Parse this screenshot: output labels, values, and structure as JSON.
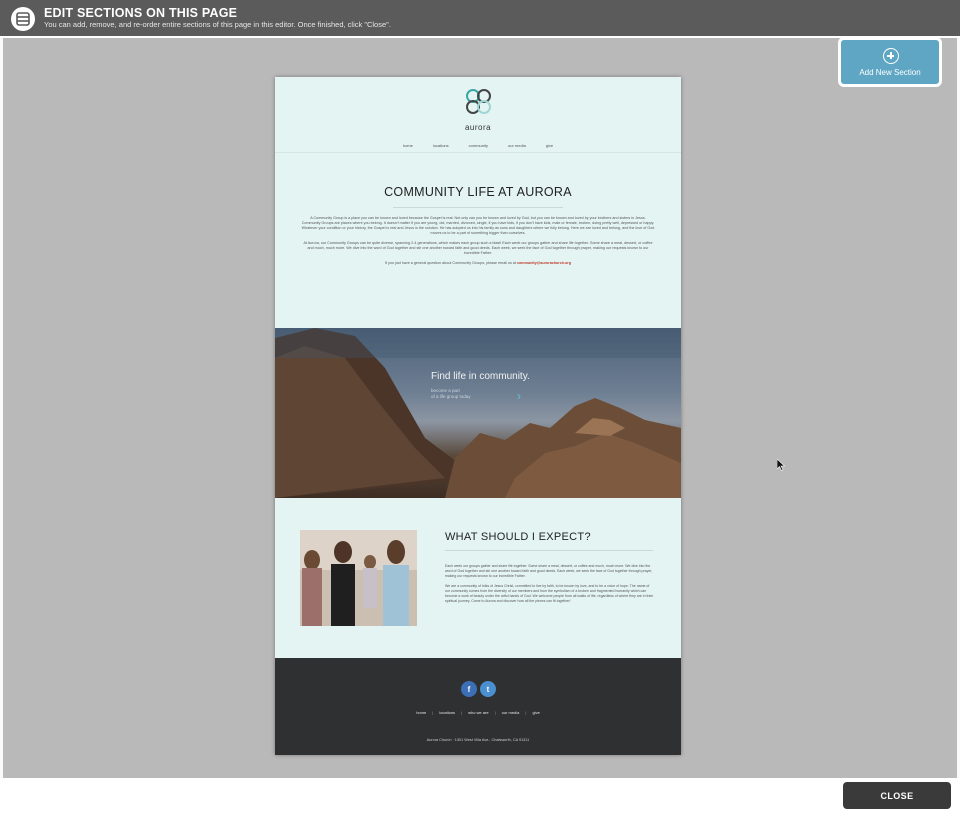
{
  "editor": {
    "title": "EDIT SECTIONS ON THIS PAGE",
    "subtitle": "You can add, remove, and re-order entire sections of this page in this editor. Once finished, click \"Close\".",
    "icon": "section-editor-icon",
    "add_section_label": "Add New Section",
    "close_label": "CLOSE"
  },
  "site": {
    "logo_text": "aurora",
    "nav": [
      "home",
      "locations",
      "community",
      "our media",
      "give"
    ]
  },
  "intro": {
    "title": "COMMUNITY LIFE AT AURORA",
    "p1": "A Community Group is a place you can be known and loved because the Gospel is real. Not only can you be known and loved by God, but you can be known and loved by your brothers and sisters in Jesus. Community Groups are places where you belong. It doesn't matter if you are young, old, married, divorced, single, if you have kids, if you don't have kids, male or female, broken, doing pretty well, depressed or happy. Whatever your condition or your history, the Gospel is real and Jesus is the solution. He has adopted us into his family as sons and daughters where we fully belong. Here we are loved and belong, and the love of God moves us to be a part of something bigger than ourselves.",
    "p2": "At Aurora, our Community Groups can be quite diverse, spanning 2-4 generations, which makes each group such a blast! Each week our groups gather and share life together. Some share a meal, dessert, or coffee and much, much more. We dive into the word of God together and stir one another toward faith and good deeds. Each week, we seek the face of God together through prayer, making our requests known to our incredible Father.",
    "p3_prefix": "If you just have a general question about Community Groups, please email us at",
    "email": "community@aurorachurch.org"
  },
  "hero": {
    "title": "Find life in community.",
    "sub1": "become a part",
    "sub2": "of a life group today",
    "arrow": "›"
  },
  "expect": {
    "title": "WHAT SHOULD I EXPECT?",
    "p1": "Each week our groups gather and share life together. Some share a meal, dessert, or coffee and much, much more. We dive into the word of God together and stir one another toward faith and good deeds. Each week, we seek the face of God together through prayer, making our requests known to our incredible Father.",
    "p2": "We are a community of folks of Jesus Christ, committed to live by faith, to be known by love, and to be a voice of hope. The name of our community comes from the diversity of our members and from the symbolism of a broken and fragmented humanity which can become a work of beauty under the artful hands of God. We welcome people from all walks of life, regardless of where they are in their spiritual journey. Come to Aurora and discover how all the pieces can fit together!"
  },
  "footer": {
    "facebook": "f",
    "twitter": "t",
    "nav": [
      "home",
      "locations",
      "who we are",
      "our media",
      "give"
    ],
    "separator": "|",
    "address": "Aurora Church · 1301 West Villa Ave., Chatsworth, CA 91311"
  }
}
